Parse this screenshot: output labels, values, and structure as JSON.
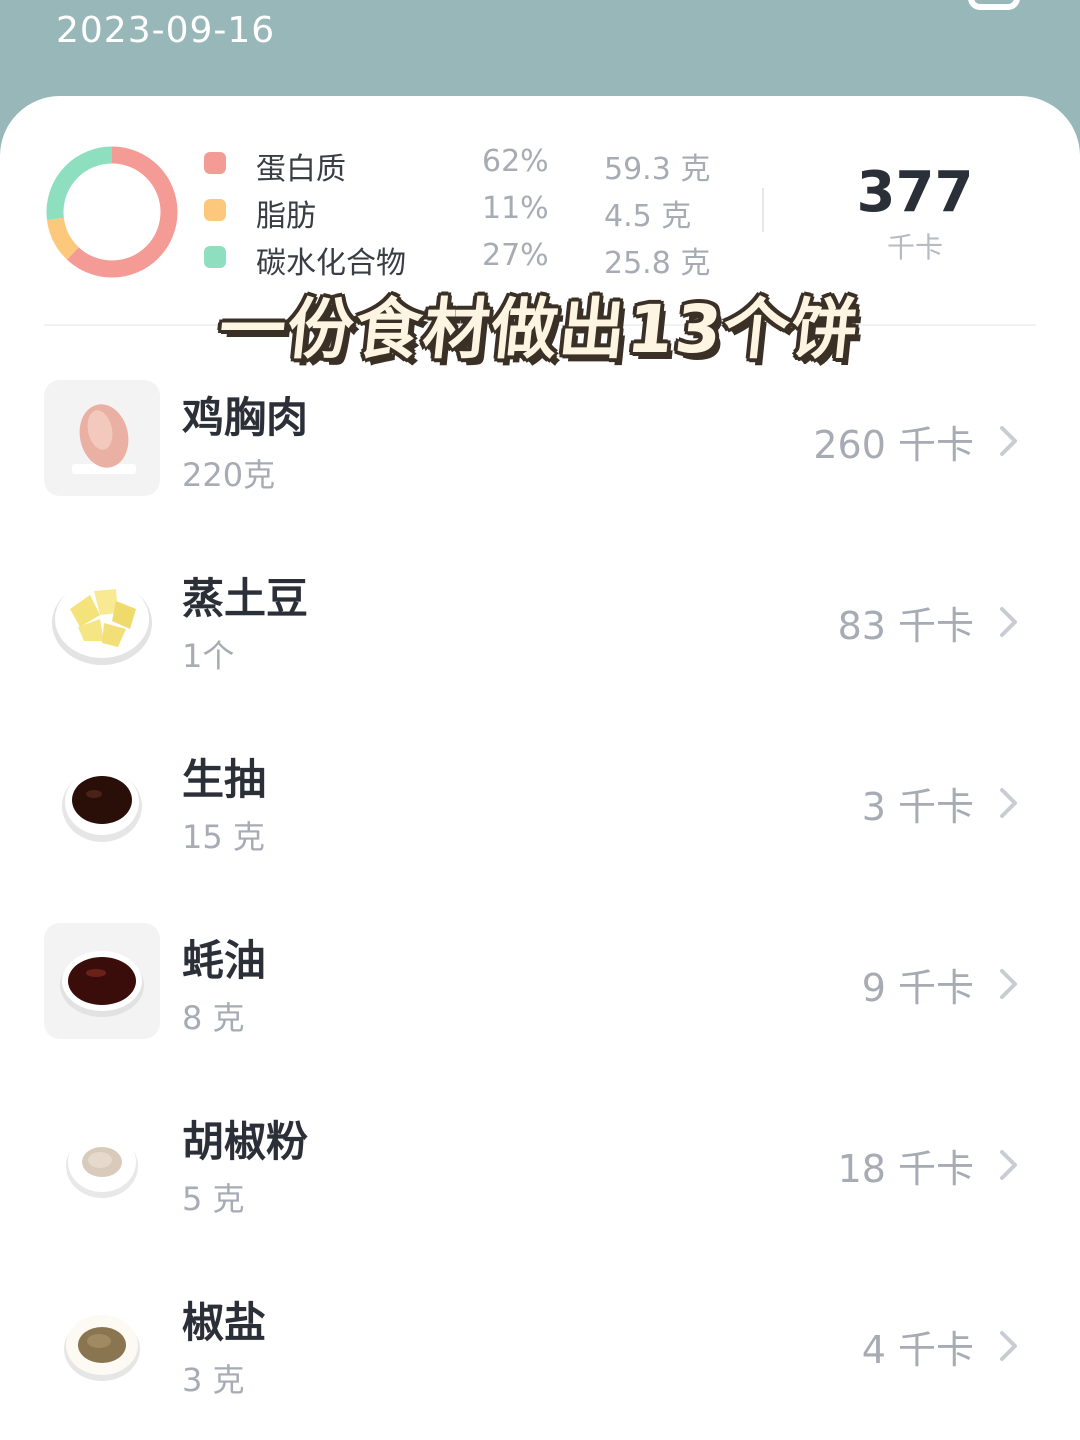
{
  "header": {
    "date": "2023-09-16"
  },
  "summary": {
    "macros": [
      {
        "name": "蛋白质",
        "percent": "62%",
        "grams": "59.3 克",
        "color": "#f59b96",
        "share": 0.62
      },
      {
        "name": "脂肪",
        "percent": "11%",
        "grams": "4.5 克",
        "color": "#fcc97c",
        "share": 0.11
      },
      {
        "name": "碳水化合物",
        "percent": "27%",
        "grams": "25.8 克",
        "color": "#8ddfbf",
        "share": 0.27
      }
    ],
    "total_kcal": "377",
    "kcal_unit": "千卡"
  },
  "overlay_caption": "一份食材做出13个饼",
  "ingredients": [
    {
      "name": "鸡胸肉",
      "amount": "220克",
      "kcal": "260 千卡",
      "icon": "chicken-breast-photo"
    },
    {
      "name": "蒸土豆",
      "amount": "1个",
      "kcal": "83 千卡",
      "icon": "steamed-potato-photo"
    },
    {
      "name": "生抽",
      "amount": "15 克",
      "kcal": "3 千卡",
      "icon": "soy-sauce-photo"
    },
    {
      "name": "蚝油",
      "amount": "8 克",
      "kcal": "9 千卡",
      "icon": "oyster-sauce-photo"
    },
    {
      "name": "胡椒粉",
      "amount": "5 克",
      "kcal": "18 千卡",
      "icon": "pepper-powder-photo"
    },
    {
      "name": "椒盐",
      "amount": "3 克",
      "kcal": "4 千卡",
      "icon": "pepper-salt-photo"
    }
  ]
}
